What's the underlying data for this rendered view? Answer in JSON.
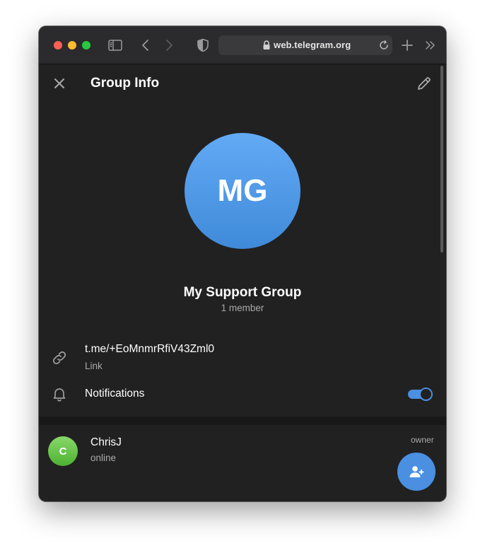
{
  "browser": {
    "url": "web.telegram.org",
    "icons": {
      "sidebar": "sidebar-toggle-icon",
      "back": "chevron-left-icon",
      "forward": "chevron-right-icon",
      "privacy": "shield-icon",
      "lock": "lock-icon",
      "reload": "reload-icon",
      "new_tab": "plus-icon",
      "more": "double-chevron-right-icon"
    },
    "traffic_lights": [
      "#fe5f57",
      "#febc2e",
      "#28c840"
    ]
  },
  "header": {
    "title": "Group Info",
    "close_icon": "close-icon",
    "edit_icon": "pencil-icon"
  },
  "group": {
    "initials": "MG",
    "name": "My Support Group",
    "members": "1 member"
  },
  "info": {
    "link": {
      "value": "t.me/+EoMnmrRfiV43Zml0",
      "caption": "Link",
      "icon": "link-icon"
    },
    "notifications": {
      "label": "Notifications",
      "icon": "bell-icon",
      "enabled": true
    }
  },
  "members": [
    {
      "initial": "C",
      "name": "ChrisJ",
      "status": "online",
      "role": "owner"
    }
  ],
  "fab": {
    "icon": "add-member-icon"
  },
  "colors": {
    "accent": "#4a8fe0",
    "background": "#212121",
    "avatar_group": "#4f97e6",
    "avatar_member": "#5cbf3f"
  }
}
